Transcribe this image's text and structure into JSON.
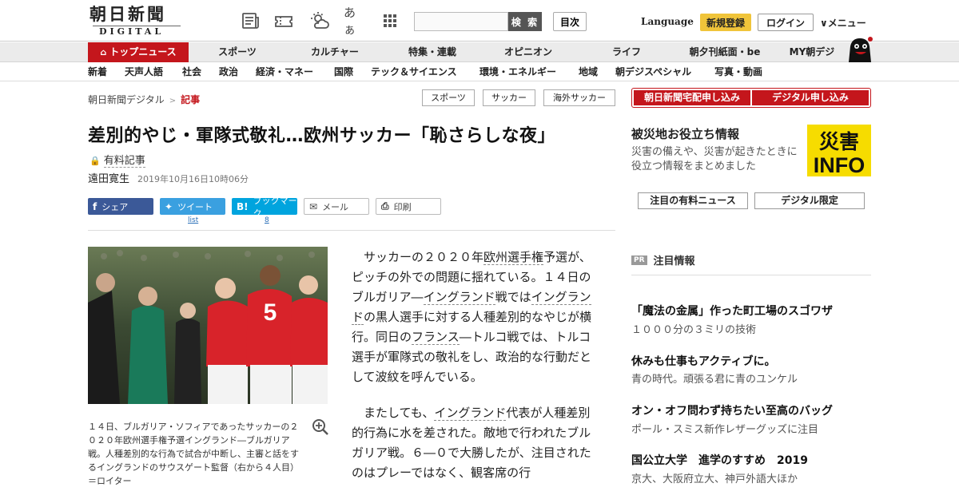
{
  "header": {
    "logo_main": "朝日新聞",
    "logo_sub": "DIGITAL",
    "font_size_label": "あぁ",
    "search_button": "検 索",
    "toc_button": "目次",
    "language": "Language",
    "register": "新規登録",
    "login": "ログイン",
    "menu": "∨メニュー"
  },
  "nav1": [
    "トップニュース",
    "スポーツ",
    "カルチャー",
    "特集・連載",
    "オピニオン",
    "ライフ",
    "朝夕刊紙面・be",
    "MY朝デジ"
  ],
  "nav2": [
    "新着",
    "天声人語",
    "社会",
    "政治",
    "経済・マネー",
    "国際",
    "テック＆サイエンス",
    "環境・エネルギー",
    "地域",
    "朝デジスペシャル",
    "写真・動画"
  ],
  "breadcrumb": {
    "home": "朝日新聞デジタル",
    "sep": ">",
    "current": "記事"
  },
  "tags": [
    "スポーツ",
    "サッカー",
    "海外サッカー"
  ],
  "article": {
    "title": "差別的やじ・軍隊式敬礼…欧州サッカー「恥さらしな夜」",
    "paid_label": "有料記事",
    "author": "遠田寛生",
    "datetime": "2019年10月16日10時06分",
    "share": {
      "facebook": "シェア",
      "twitter": "ツイート",
      "hatena": "ブックマーク",
      "mail": "メール",
      "print": "印刷",
      "twitter_count": "list",
      "hatena_count": "8"
    },
    "caption": "１４日、ブルガリア・ソフィアであったサッカーの２０２０年欧州選手権予選イングランド―ブルガリア戦。人種差別的な行為で試合が中断し、主審と話をするイングランドのサウスゲート監督（右から４人目）＝ロイター",
    "p1": [
      "サッカーの２０２０年",
      "欧州選手権",
      "予選が、ピッチの外での問題に揺れている。１４日のブルガリア―",
      "イングランド",
      "戦では",
      "イングランド",
      "の黒人選手に対する人種差別的なやじが横行。同日の",
      "フランス",
      "―トルコ戦では、トルコ選手が軍隊式の敬礼をし、政治的な行動だとして波紋を呼んでいる。"
    ],
    "p2": [
      "またしても、",
      "イングランド",
      "代表が人種差別的行為に水を差された。敵地で行われたブルガリア戦。６―０で大勝したが、注目されたのはプレーではなく、観客席の行"
    ]
  },
  "sidebar": {
    "btn_delivery": "朝日新聞宅配申し込み",
    "btn_digital": "デジタル申し込み",
    "disaster_title": "被災地お役立ち情報",
    "disaster_desc": "災害の備えや、災害が起きたときに役立つ情報をまとめました",
    "disaster_logo_top": "災害",
    "disaster_logo_bot": "INFO",
    "tab_paid": "注目の有料ニュース",
    "tab_digital": "デジタル限定",
    "pr_badge": "PR",
    "pr_title": "注目情報",
    "items": [
      {
        "title": "「魔法の金属」作った町工場のスゴワザ",
        "sub": "１０００分の３ミリの技術"
      },
      {
        "title": "休みも仕事もアクティブに。",
        "sub": "青の時代。頑張る君に青のユンケル"
      },
      {
        "title": "オン・オフ問わず持ちたい至高のバッグ",
        "sub": "ポール・スミス新作レザーグッズに注目"
      },
      {
        "title": "国公立大学　進学のすすめ　2019",
        "sub": "京大、大阪府立大、神戸外語大ほか"
      }
    ]
  },
  "colors": {
    "brand_red": "#c4161c",
    "register_yellow": "#f0c43a",
    "disaster_yellow": "#f6dc00"
  }
}
